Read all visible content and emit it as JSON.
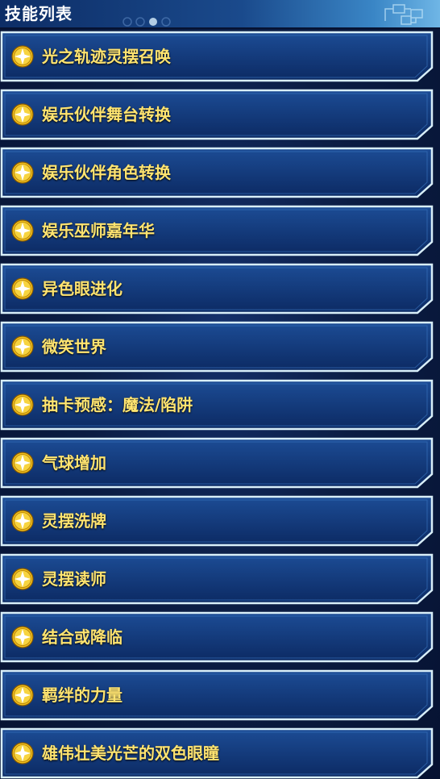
{
  "header": {
    "title": "技能列表"
  },
  "colors": {
    "item_text": "#ffe470",
    "item_border": "#d8eef8",
    "item_fill_top": "#1c4c95",
    "item_fill_bottom": "#0c2a63",
    "icon_gold": "#f2c21b"
  },
  "skills": [
    {
      "label": "光之轨迹灵摆召唤",
      "icon": "star-diamond-icon"
    },
    {
      "label": "娱乐伙伴舞台转换",
      "icon": "star-diamond-icon"
    },
    {
      "label": "娱乐伙伴角色转换",
      "icon": "star-diamond-icon"
    },
    {
      "label": "娱乐巫师嘉年华",
      "icon": "star-diamond-icon"
    },
    {
      "label": "异色眼进化",
      "icon": "star-diamond-icon"
    },
    {
      "label": "微笑世界",
      "icon": "star-diamond-icon"
    },
    {
      "label": "抽卡预感：魔法/陷阱",
      "icon": "star-diamond-icon"
    },
    {
      "label": "气球增加",
      "icon": "star-diamond-icon"
    },
    {
      "label": "灵摆洗牌",
      "icon": "star-diamond-icon"
    },
    {
      "label": "灵摆读师",
      "icon": "star-diamond-icon"
    },
    {
      "label": "结合或降临",
      "icon": "star-diamond-icon"
    },
    {
      "label": "羁绊的力量",
      "icon": "star-diamond-icon"
    },
    {
      "label": "雄伟壮美光芒的双色眼瞳",
      "icon": "star-diamond-icon"
    }
  ]
}
